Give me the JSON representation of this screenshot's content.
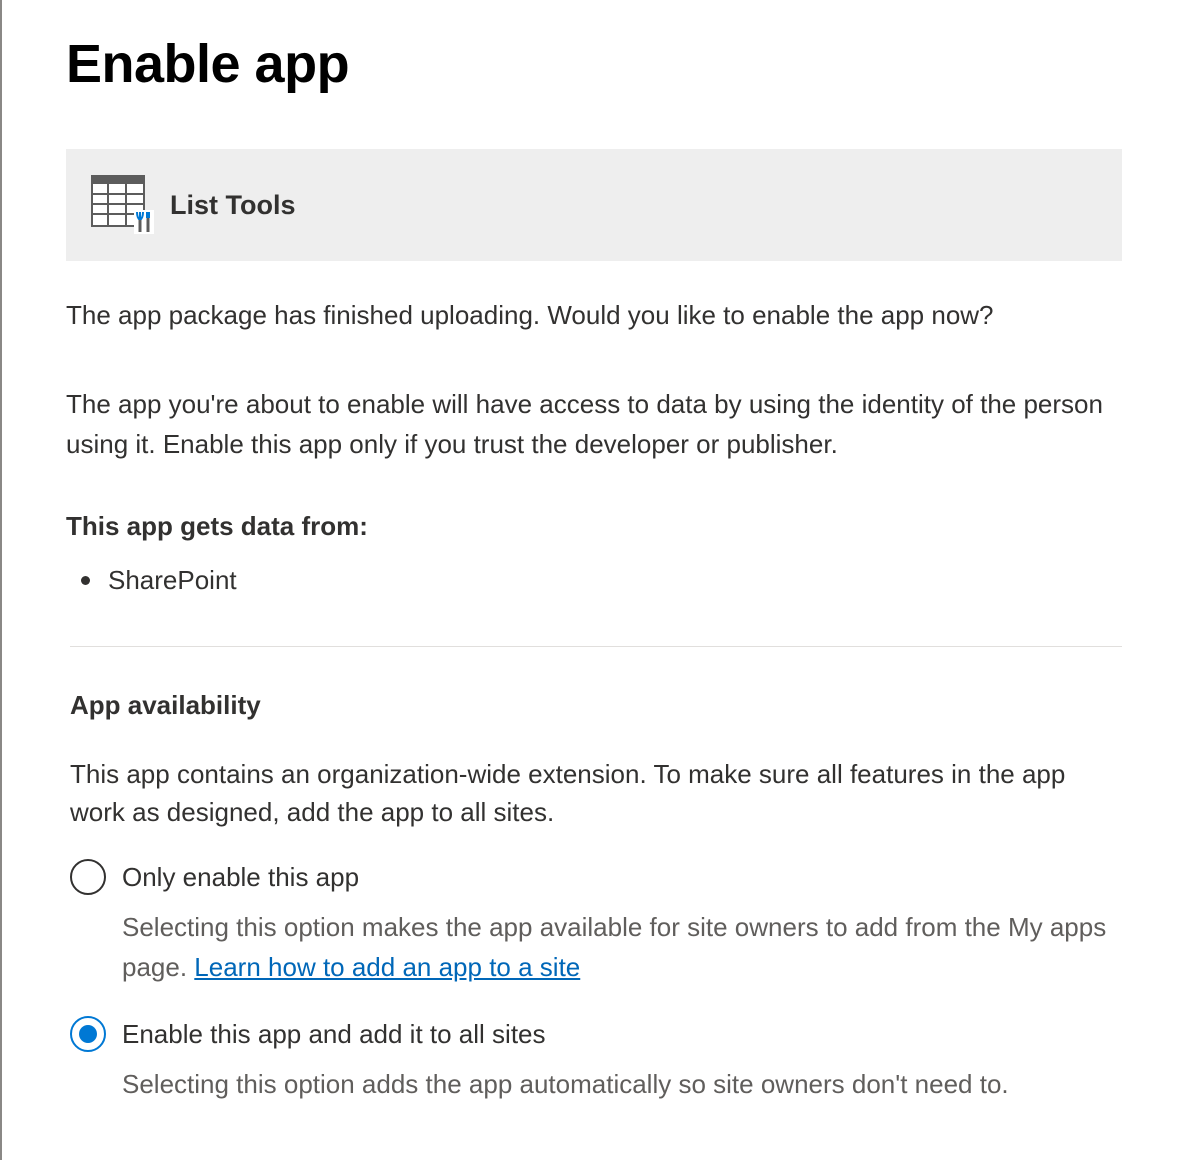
{
  "dialog": {
    "title": "Enable app"
  },
  "app": {
    "name": "List Tools",
    "icon": "list-tools-icon"
  },
  "body": {
    "upload_message": "The app package has finished uploading. Would you like to enable the app now?",
    "trust_message": "The app you're about to enable will have access to data by using the identity of the person using it. Enable this app only if you trust the developer or publisher.",
    "data_sources_label": "This app gets data from:",
    "data_sources": [
      "SharePoint"
    ]
  },
  "availability": {
    "title": "App availability",
    "description": "This app contains an organization-wide extension. To make sure all features in the app work as designed, add the app to all sites.",
    "options": [
      {
        "label": "Only enable this app",
        "description": "Selecting this option makes the app available for site owners to add from the My apps page.",
        "link_text": "Learn how to add an app to a site",
        "selected": false
      },
      {
        "label": "Enable this app and add it to all sites",
        "description": "Selecting this option adds the app automatically so site owners don't need to.",
        "selected": true
      }
    ]
  },
  "colors": {
    "accent": "#0078d4",
    "link": "#0067b8",
    "card_background": "#eeeeee",
    "text": "#323130"
  }
}
